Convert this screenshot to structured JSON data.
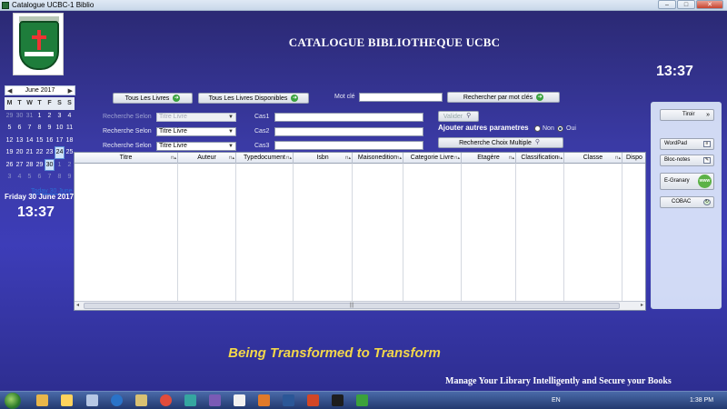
{
  "window": {
    "title": "Catalogue UCBC-1 Biblio"
  },
  "header": {
    "title": "CATALOGUE BIBLIOTHEQUE UCBC",
    "time_right": "13:37"
  },
  "calendar": {
    "month_label": "June 2017",
    "prev": "◀",
    "next": "▶",
    "dow": [
      "M",
      "T",
      "W",
      "T",
      "F",
      "S",
      "S"
    ],
    "weeks": [
      [
        "29",
        "30",
        "31",
        "1",
        "2",
        "3",
        "4"
      ],
      [
        "5",
        "6",
        "7",
        "8",
        "9",
        "10",
        "11"
      ],
      [
        "12",
        "13",
        "14",
        "15",
        "16",
        "17",
        "18"
      ],
      [
        "19",
        "20",
        "21",
        "22",
        "23",
        "24",
        "25"
      ],
      [
        "26",
        "27",
        "28",
        "29",
        "30",
        "1",
        "2"
      ],
      [
        "3",
        "4",
        "5",
        "6",
        "7",
        "8",
        "9"
      ]
    ],
    "today_link": "Today 30 June 2017",
    "date_text": "Friday 30 June 2017",
    "time_left": "13:37"
  },
  "toolbar": {
    "all_books": "Tous Les Livres",
    "available_books": "Tous Les Livres Disponibles",
    "keyword_label": "Mot clé",
    "keyword_value": "",
    "search_keywords": "Rechercher par mot clés",
    "search_by_label": "Recherche Selon",
    "select1": "Titre Livre",
    "select2": "Titre Livre",
    "select3": "Titre Livre",
    "cas1": "Cas1",
    "cas2": "Cas2",
    "cas3": "Cas3",
    "validate": "Valider",
    "add_params": "Ajouter autres parametres",
    "non": "Non",
    "oui": "Oui",
    "multi_search": "Recherche Choix Multiple"
  },
  "table": {
    "columns": [
      "Titre",
      "Auteur",
      "Typedocument",
      "Isbn",
      "Maisonedition",
      "Categorie Livre",
      "Etagère",
      "Classification",
      "Classe",
      "Dispo"
    ],
    "scroll_grip": "|||"
  },
  "panel": {
    "tiroir": "Tiroir",
    "wordpad": "WordPad",
    "notepad": "Bloc-notes",
    "egranary": "E-Granary",
    "egranary_badge": "www",
    "cobac": "COBAC"
  },
  "footer": {
    "slogan": "Being Transformed to Transform",
    "note": "Manage Your Library Intelligently and Secure your Books"
  },
  "taskbar": {
    "lang": "EN",
    "clock": "1:38 PM"
  },
  "colors": {
    "accent_green": "#3aa23f",
    "background": "#3a3aa4",
    "slogan": "#f3d74a"
  }
}
